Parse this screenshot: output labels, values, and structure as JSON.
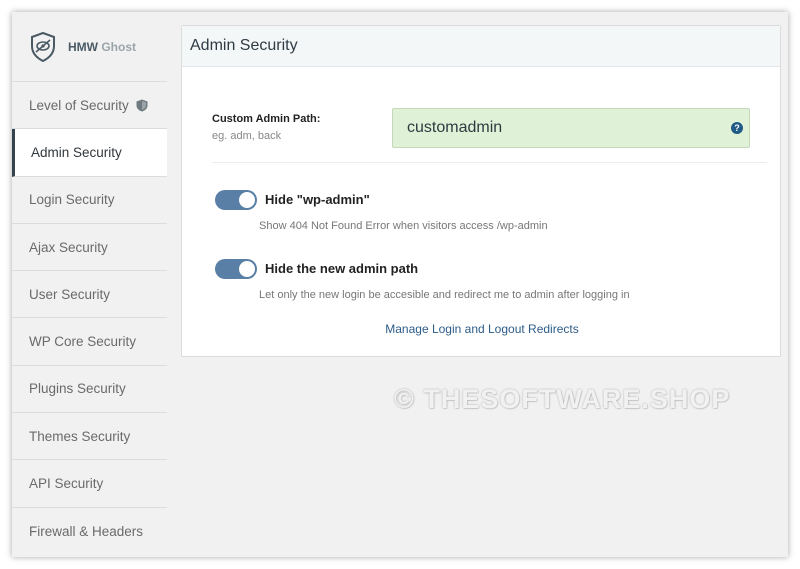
{
  "brand": {
    "name_main": "HMW",
    "name_light": "Ghost"
  },
  "sidebar": {
    "items": [
      {
        "label": "Level of Security"
      },
      {
        "label": "Admin Security"
      },
      {
        "label": "Login Security"
      },
      {
        "label": "Ajax Security"
      },
      {
        "label": "User Security"
      },
      {
        "label": "WP Core Security"
      },
      {
        "label": "Plugins Security"
      },
      {
        "label": "Themes Security"
      },
      {
        "label": "API Security"
      },
      {
        "label": "Firewall & Headers"
      }
    ],
    "active_index": 1
  },
  "card": {
    "title": "Admin Security",
    "custom_path": {
      "label": "Custom Admin Path:",
      "hint": "eg. adm, back",
      "value": "customadmin",
      "help_symbol": "?"
    },
    "toggles": [
      {
        "title": "Hide \"wp-admin\"",
        "description": "Show 404 Not Found Error when visitors access /wp-admin",
        "on": true
      },
      {
        "title": "Hide the new admin path",
        "description": "Let only the new login be accesible and redirect me to admin after logging in",
        "on": true
      }
    ],
    "link": "Manage Login and Logout Redirects"
  },
  "watermark": "© THESOFTWARE.SHOP",
  "colors": {
    "accent": "#36434c",
    "toggle_on": "#5a7fa7",
    "input_bg": "#dff2d8",
    "link": "#2d5c88"
  }
}
